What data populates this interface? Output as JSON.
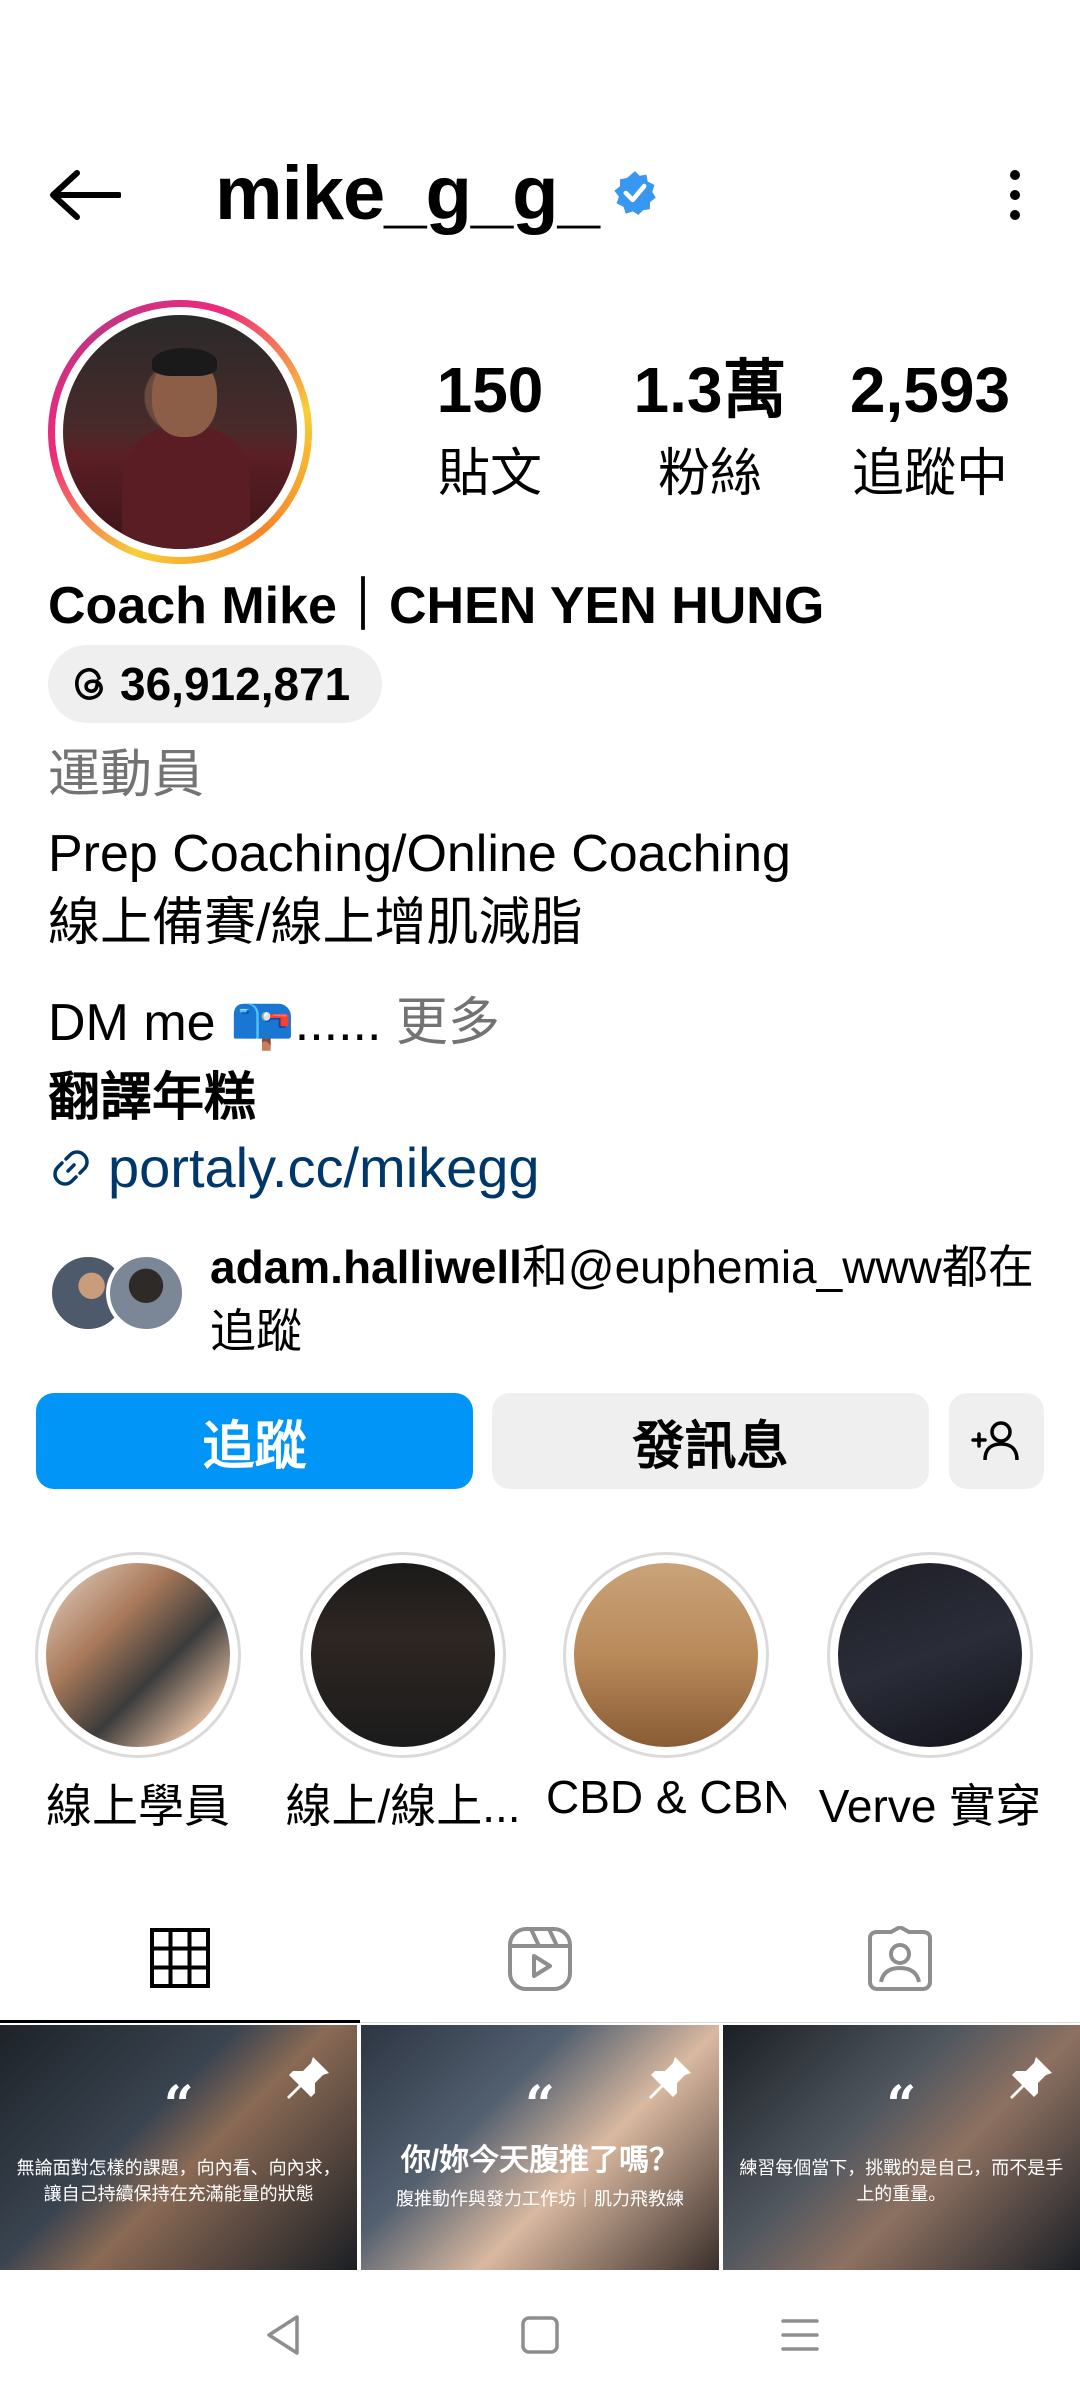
{
  "header": {
    "username": "mike_g_g_",
    "verified": true
  },
  "profile": {
    "full_name": "Coach Mike｜CHEN YEN HUNG",
    "threads_count": "36,912,871",
    "category": "運動員",
    "bio_lines": [
      "Prep Coaching/Online Coaching",
      "線上備賽/線上增肌減脂",
      "DM me 📪......"
    ],
    "bio_more": " 更多",
    "translate": "翻譯年糕",
    "link": "portaly.cc/mikegg"
  },
  "stats": [
    {
      "value": "150",
      "label": "貼文"
    },
    {
      "value": "1.3萬",
      "label": "粉絲"
    },
    {
      "value": "2,593",
      "label": "追蹤中"
    }
  ],
  "followed_by": {
    "user1": "adam.halliwell",
    "text": "和@euphemia_www都在追蹤"
  },
  "buttons": {
    "follow": "追蹤",
    "message": "發訊息"
  },
  "highlights": [
    {
      "label": "線上學員"
    },
    {
      "label": "線上/線上..."
    },
    {
      "label": "CBD & CBN"
    },
    {
      "label": "Verve 實穿"
    }
  ],
  "posts": [
    {
      "text": "無論面對怎樣的課題，向內看、向內求，讓自己持續保持在充滿能量的狀態"
    },
    {
      "title": "你/妳今天腹推了嗎？",
      "sub": "腹推動作與發力工作坊｜肌力飛教練"
    },
    {
      "text": "練習每個當下，挑戰的是自己，而不是手上的重量。"
    }
  ],
  "colors": {
    "accent": "#0095f6",
    "link": "#00376b",
    "muted": "#737373",
    "button_bg": "#efefef"
  }
}
